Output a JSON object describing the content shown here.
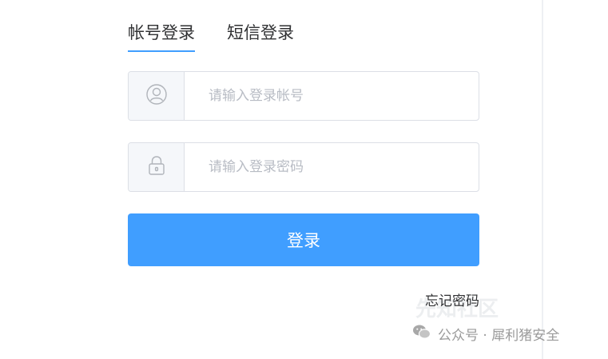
{
  "tabs": [
    {
      "label": "帐号登录",
      "active": true
    },
    {
      "label": "短信登录",
      "active": false
    }
  ],
  "account": {
    "placeholder": "请输入登录帐号",
    "value": "",
    "icon": "user-icon"
  },
  "password": {
    "placeholder": "请输入登录密码",
    "value": "",
    "icon": "lock-icon"
  },
  "login_button": "登录",
  "forgot_password": "忘记密码",
  "watermarks": {
    "community": "先知社区",
    "wechat_account": "公众号 · 犀利猪安全"
  },
  "colors": {
    "accent": "#409eff",
    "border": "#dcdfe6",
    "prefix_bg": "#f5f7fa",
    "placeholder": "#b8bcc4"
  }
}
